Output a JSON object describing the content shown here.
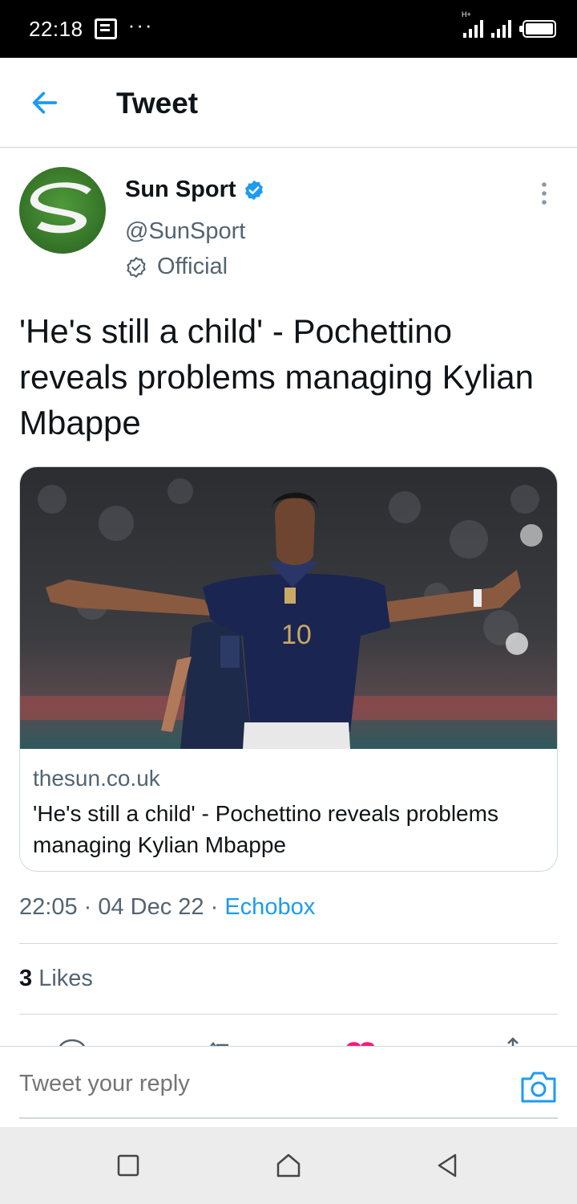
{
  "status_bar": {
    "time": "22:18",
    "dots": "···",
    "network_label": "H+"
  },
  "header": {
    "title": "Tweet"
  },
  "tweet": {
    "author_name": "Sun Sport",
    "handle": "@SunSport",
    "label": "Official",
    "text": "'He's still a child' - Pochettino reveals problems managing Kylian Mbappe",
    "card": {
      "domain": "thesun.co.uk",
      "title": "'He's still a child' - Pochettino reveals problems managing Kylian Mbappe"
    },
    "time": "22:05",
    "date": "04 Dec 22",
    "source": "Echobox",
    "separator": " · ",
    "likes_count": "3",
    "likes_label": " Likes"
  },
  "reply": {
    "placeholder": "Tweet your reply"
  },
  "colors": {
    "accent": "#1d9bf0",
    "secondary_text": "#536471",
    "like": "#f91880"
  },
  "icons": [
    "back-arrow-icon",
    "verified-badge-icon",
    "official-badge-icon",
    "more-options-icon",
    "camera-icon",
    "recents-icon",
    "home-icon",
    "back-icon"
  ]
}
